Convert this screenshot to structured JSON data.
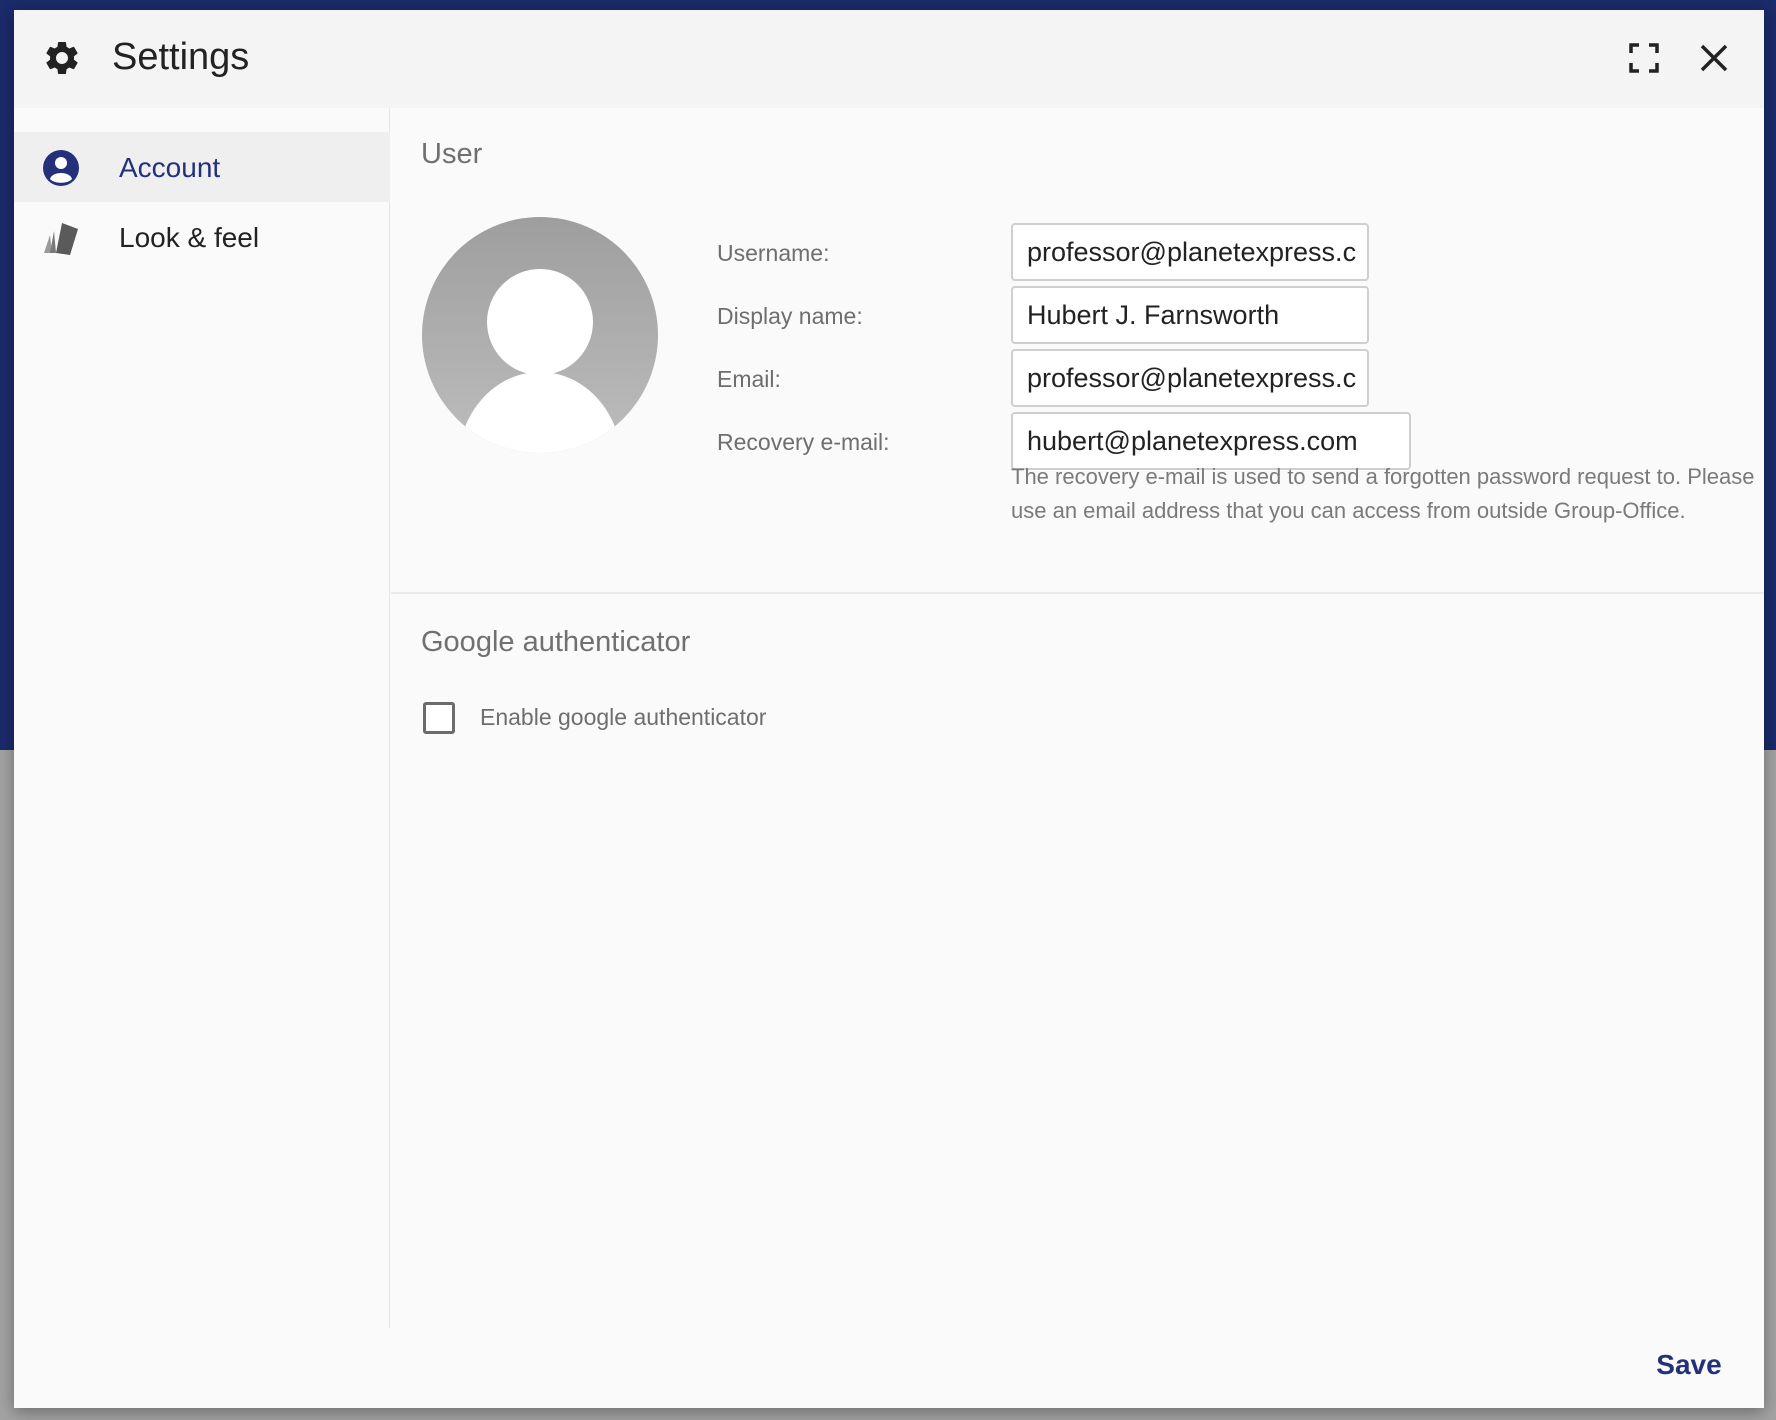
{
  "dialog": {
    "title": "Settings",
    "title_icon": "gear-icon",
    "maximize_icon": "maximize-icon",
    "close_icon": "close-icon"
  },
  "sidebar": {
    "items": [
      {
        "label": "Account",
        "icon": "account-circle-icon",
        "active": true
      },
      {
        "label": "Look & feel",
        "icon": "style-cards-icon",
        "active": false
      }
    ]
  },
  "user_section": {
    "title": "User",
    "avatar_icon": "default-avatar",
    "fields": [
      {
        "label": "Username:",
        "value": "professor@planetexpress.c"
      },
      {
        "label": "Display name:",
        "value": "Hubert J. Farnsworth"
      },
      {
        "label": "Email:",
        "value": "professor@planetexpress.c"
      },
      {
        "label": "Recovery e-mail:",
        "value": "hubert@planetexpress.com"
      }
    ],
    "help_text": "The recovery e-mail is used to send a forgotten password request to. Please use an email address that you can access from outside Group-Office."
  },
  "google_section": {
    "title": "Google authenticator",
    "checkbox_label": "Enable google authenticator",
    "checked": false
  },
  "footer": {
    "save_label": "Save"
  },
  "colors": {
    "accent": "#24317a",
    "backdrop_top": "#1b2b6b",
    "dialog_bg": "#fafafa"
  }
}
